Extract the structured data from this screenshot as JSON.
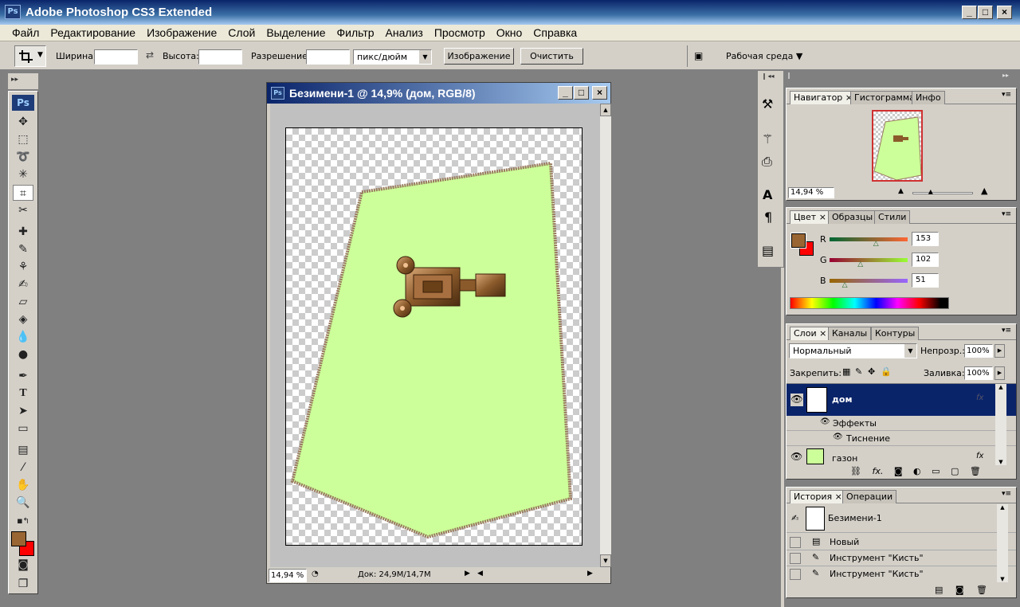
{
  "app": {
    "title": "Adobe Photoshop CS3 Extended",
    "logo": "Ps",
    "window_buttons": [
      "_",
      "□",
      "×"
    ]
  },
  "menu": [
    "Файл",
    "Редактирование",
    "Изображение",
    "Слой",
    "Выделение",
    "Фильтр",
    "Анализ",
    "Просмотр",
    "Окно",
    "Справка"
  ],
  "options": {
    "width_label": "Ширина:",
    "width_value": "",
    "height_label": "Высота:",
    "height_value": "",
    "resolution_label": "Разрешение:",
    "resolution_value": "",
    "units": "пикс/дюйм",
    "image_button": "Изображение",
    "clear_button": "Очистить",
    "workspace": "Рабочая среда ▼"
  },
  "toolbox": {
    "logo": "Ps",
    "foreground_color": "#996633",
    "background_color": "#ff0000"
  },
  "document": {
    "title": "Безимени-1 @ 14,9% (дом, RGB/8)",
    "zoom": "14,94 %",
    "doc_size": "Док: 24,9М/14,7М",
    "lawn_color": "#ccff99",
    "shape_color": "#8b5a2b"
  },
  "navigator": {
    "tabs": [
      "Навигатор",
      "Гистограмма",
      "Инфо"
    ],
    "zoom": "14,94 %",
    "zoom_level": 0.3
  },
  "color": {
    "tabs": [
      "Цвет",
      "Образцы",
      "Стили"
    ],
    "channels": [
      {
        "name": "R",
        "value": "153"
      },
      {
        "name": "G",
        "value": "102"
      },
      {
        "name": "B",
        "value": "51"
      }
    ]
  },
  "layers": {
    "tabs": [
      "Слои",
      "Каналы",
      "Контуры"
    ],
    "blend_mode": "Нормальный",
    "opacity_label": "Непрозр.:",
    "opacity": "100%",
    "lock_label": "Закрепить:",
    "fill_label": "Заливка:",
    "fill": "100%",
    "items": [
      {
        "name": "дом",
        "selected": true
      },
      {
        "name": "Эффекты",
        "sub": true
      },
      {
        "name": "Тиснение",
        "sub2": true
      },
      {
        "name": "газон",
        "selected": false
      }
    ]
  },
  "history": {
    "tabs": [
      "История",
      "Операции"
    ],
    "snapshot": "Безимени-1",
    "items": [
      "Новый",
      "Инструмент \"Кисть\"",
      "Инструмент \"Кисть\""
    ]
  }
}
